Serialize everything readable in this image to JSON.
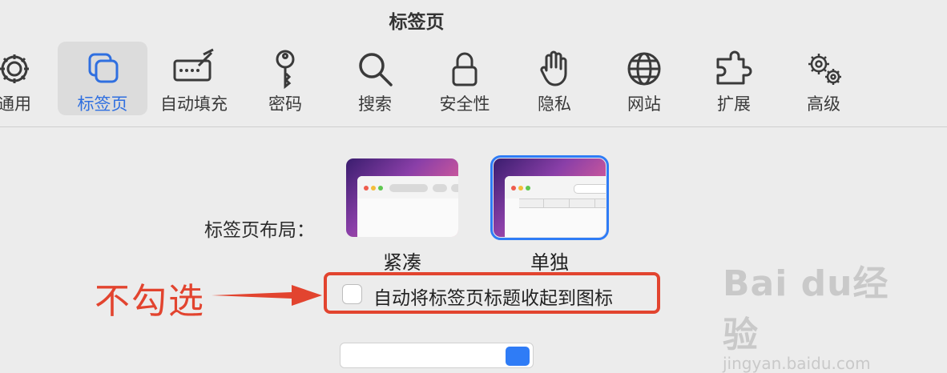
{
  "window": {
    "title": "标签页"
  },
  "toolbar": {
    "items": [
      {
        "label": "通用",
        "icon": "gear-icon"
      },
      {
        "label": "标签页",
        "icon": "tabs-icon",
        "active": true
      },
      {
        "label": "自动填充",
        "icon": "autofill-icon"
      },
      {
        "label": "密码",
        "icon": "key-icon"
      },
      {
        "label": "搜索",
        "icon": "search-icon"
      },
      {
        "label": "安全性",
        "icon": "lock-icon"
      },
      {
        "label": "隐私",
        "icon": "hand-icon"
      },
      {
        "label": "网站",
        "icon": "globe-icon"
      },
      {
        "label": "扩展",
        "icon": "puzzle-icon"
      },
      {
        "label": "高级",
        "icon": "gears-icon"
      }
    ]
  },
  "tab_layout": {
    "label": "标签页布局：",
    "options": [
      {
        "label": "紧凑",
        "selected": false
      },
      {
        "label": "单独",
        "selected": true
      }
    ]
  },
  "checkbox": {
    "label": "自动将标签页标题收起到图标",
    "checked": false
  },
  "annotation": {
    "text": "不勾选",
    "color": "#e2442f"
  },
  "watermark": {
    "brand": "Bai du经验",
    "url": "jingyan.baidu.com"
  },
  "colors": {
    "accent": "#2f7cf6",
    "background": "#ececec"
  }
}
